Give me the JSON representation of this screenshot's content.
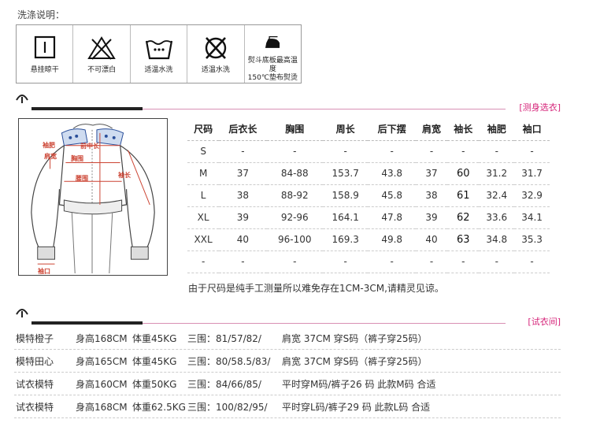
{
  "wash": {
    "title": "洗涤说明：",
    "items": [
      {
        "label": "悬挂晾干",
        "icon": "hang-dry-icon"
      },
      {
        "label": "不可漂白",
        "icon": "no-bleach-icon"
      },
      {
        "label": "适温水洗",
        "icon": "warm-wash-icon"
      },
      {
        "label": "适温水洗",
        "icon": "no-tumble-dry-icon"
      },
      {
        "label": "熨斗底板最高温度",
        "label2": "150℃垫布熨烫",
        "icon": "iron-icon"
      }
    ]
  },
  "measure_section": {
    "tag": "[测身选衣]",
    "labels": {
      "sleeve_top": "袖肥",
      "shoulder": "肩宽",
      "front_length": "前中长",
      "chest": "胸围",
      "waist": "腰围",
      "sleeve_length": "袖长",
      "cuff": "袖口"
    }
  },
  "size_table": {
    "headers": [
      "尺码",
      "后衣长",
      "胸围",
      "周长",
      "后下摆",
      "肩宽",
      "袖长",
      "袖肥",
      "袖口"
    ],
    "rows": [
      [
        "S",
        "-",
        "-",
        "-",
        "-",
        "-",
        "-",
        "-",
        "-"
      ],
      [
        "M",
        "37",
        "84-88",
        "153.7",
        "43.8",
        "37",
        "60",
        "31.2",
        "31.7"
      ],
      [
        "L",
        "38",
        "88-92",
        "158.9",
        "45.8",
        "38",
        "61",
        "32.4",
        "32.9"
      ],
      [
        "XL",
        "39",
        "92-96",
        "164.1",
        "47.8",
        "39",
        "62",
        "33.6",
        "34.1"
      ],
      [
        "XXL",
        "40",
        "96-100",
        "169.3",
        "49.8",
        "40",
        "63",
        "34.8",
        "35.3"
      ],
      [
        "-",
        "-",
        "-",
        "-",
        "-",
        "-",
        "-",
        "-",
        "-"
      ]
    ]
  },
  "note": "由于尺码是纯手工测量所以难免存在1CM-3CM,请精灵见谅。",
  "fitting_section": {
    "tag": "[试衣间]"
  },
  "models": [
    {
      "name": "模特橙子",
      "height": "身高168CM",
      "weight": "体重45KG",
      "bust": "三围：81/57/82/",
      "detail": "肩宽 37CM    穿S码（裤子穿25码）"
    },
    {
      "name": "模特田心",
      "height": "身高165CM",
      "weight": "体重45KG",
      "bust": "三围：80/58.5/83/",
      "detail": "肩宽 37CM    穿S码（裤子穿25码）"
    },
    {
      "name": "试衣模特",
      "height": "身高160CM",
      "weight": "体重50KG",
      "bust": "三围：84/66/85/",
      "detail": "平时穿M码/裤子26 码 此款M码 合适"
    },
    {
      "name": "试衣模特",
      "height": "身高168CM",
      "weight": "体重62.5KG",
      "bust": "三围：100/82/95/",
      "detail": "平时穿L码/裤子29 码 此款L码 合适"
    }
  ]
}
